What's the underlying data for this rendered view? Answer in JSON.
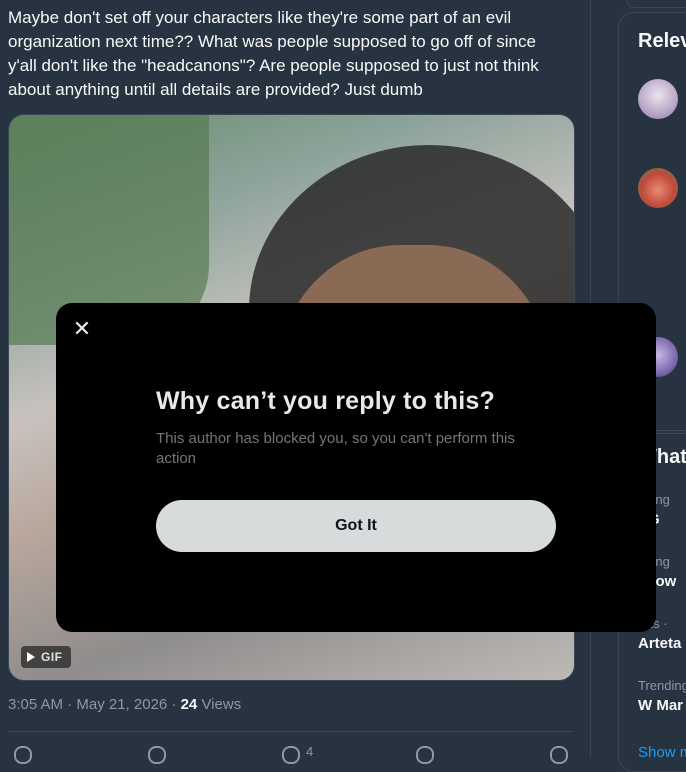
{
  "tweet": {
    "text": "Maybe don't set off your characters like they're some part of an evil organization next time?? What was people supposed to go off of since y'all don't like the \"headcanons\"? Are people supposed to just not think about anything until all details are provided? Just dumb",
    "media_badge": "GIF",
    "meta_time": "3:05 AM · May 21, 2026 · ",
    "meta_views_count": "24",
    "meta_views_label": " Views",
    "like_count": "4"
  },
  "sidebar": {
    "relevant_heading": "Relev",
    "whats_heading": "What",
    "trends": [
      {
        "context": "nding",
        "name": "SG"
      },
      {
        "context": "nding",
        "name": "abow"
      },
      {
        "context": "orts ·",
        "name": "Arteta"
      },
      {
        "context": "Trending",
        "name": "W Mar"
      }
    ],
    "show_more": "Show m"
  },
  "modal": {
    "close_glyph": "✕",
    "title": "Why can’t you reply to this?",
    "body": "This author has blocked you, so you can't perform this action",
    "button_label": "Got It"
  },
  "colors": {
    "page_bg": "#273340",
    "modal_bg": "#000000",
    "button_bg": "#d7dbdc",
    "link": "#1d9bf0"
  }
}
